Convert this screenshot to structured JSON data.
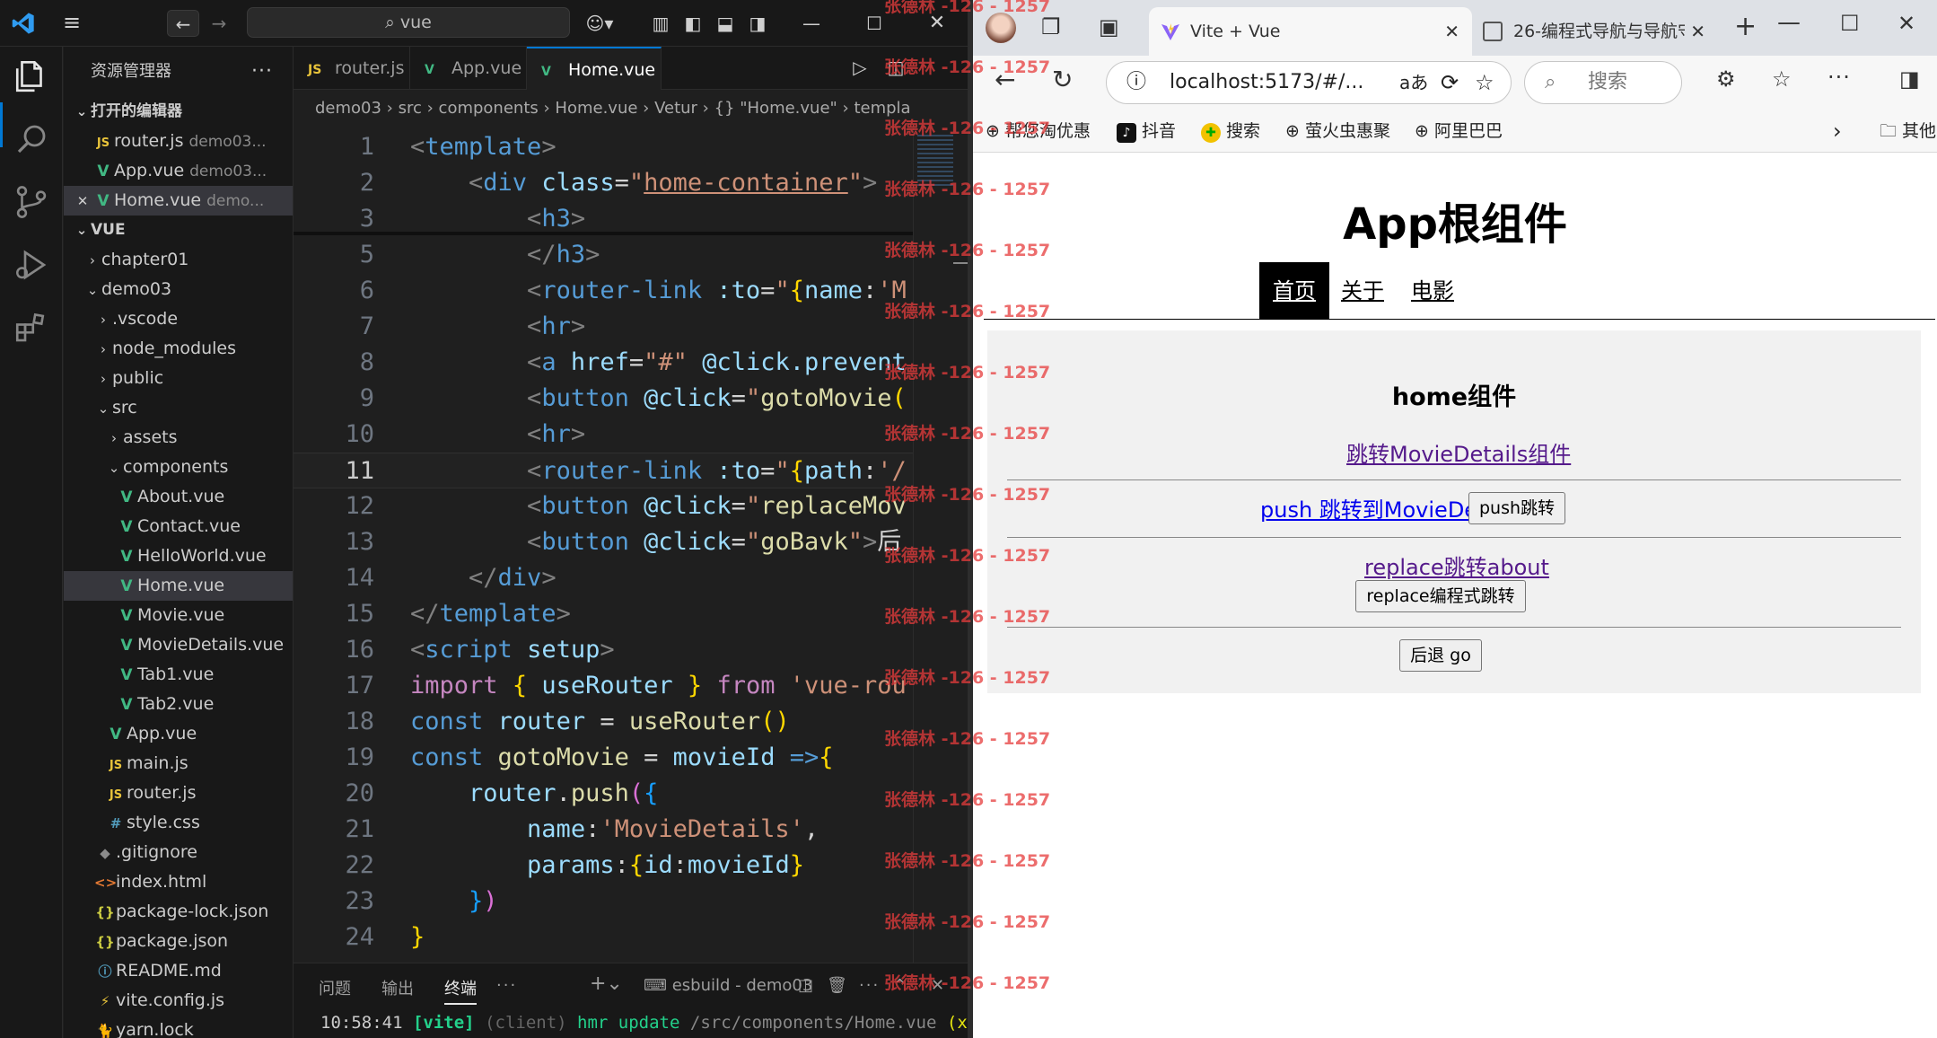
{
  "vscode": {
    "search_text": "vue",
    "explorer_title": "资源管理器",
    "open_editors_label": "打开的编辑器",
    "open_editors": [
      {
        "icon": "JS",
        "name": "router.js",
        "desc": "demo03..."
      },
      {
        "icon": "V",
        "name": "App.vue",
        "desc": "demo03..."
      },
      {
        "icon": "V",
        "name": "Home.vue",
        "desc": "demo..."
      }
    ],
    "workspace_label": "VUE",
    "tree": [
      {
        "name": "chapter01",
        "depth": 1,
        "type": "folder",
        "state": "closed"
      },
      {
        "name": "demo03",
        "depth": 1,
        "type": "folder",
        "state": "open"
      },
      {
        "name": ".vscode",
        "depth": 2,
        "type": "folder",
        "state": "closed"
      },
      {
        "name": "node_modules",
        "depth": 2,
        "type": "folder",
        "state": "closed"
      },
      {
        "name": "public",
        "depth": 2,
        "type": "folder",
        "state": "closed"
      },
      {
        "name": "src",
        "depth": 2,
        "type": "folder",
        "state": "open"
      },
      {
        "name": "assets",
        "depth": 3,
        "type": "folder",
        "state": "closed"
      },
      {
        "name": "components",
        "depth": 3,
        "type": "folder",
        "state": "open"
      },
      {
        "name": "About.vue",
        "depth": 4,
        "type": "vue"
      },
      {
        "name": "Contact.vue",
        "depth": 4,
        "type": "vue"
      },
      {
        "name": "HelloWorld.vue",
        "depth": 4,
        "type": "vue"
      },
      {
        "name": "Home.vue",
        "depth": 4,
        "type": "vue",
        "selected": true
      },
      {
        "name": "Movie.vue",
        "depth": 4,
        "type": "vue"
      },
      {
        "name": "MovieDetails.vue",
        "depth": 4,
        "type": "vue"
      },
      {
        "name": "Tab1.vue",
        "depth": 4,
        "type": "vue"
      },
      {
        "name": "Tab2.vue",
        "depth": 4,
        "type": "vue"
      },
      {
        "name": "App.vue",
        "depth": 3,
        "type": "vue"
      },
      {
        "name": "main.js",
        "depth": 3,
        "type": "js"
      },
      {
        "name": "router.js",
        "depth": 3,
        "type": "js"
      },
      {
        "name": "style.css",
        "depth": 3,
        "type": "css"
      },
      {
        "name": ".gitignore",
        "depth": 2,
        "type": "git"
      },
      {
        "name": "index.html",
        "depth": 2,
        "type": "html"
      },
      {
        "name": "package-lock.json",
        "depth": 2,
        "type": "json"
      },
      {
        "name": "package.json",
        "depth": 2,
        "type": "json"
      },
      {
        "name": "README.md",
        "depth": 2,
        "type": "info"
      },
      {
        "name": "vite.config.js",
        "depth": 2,
        "type": "vite"
      },
      {
        "name": "yarn.lock",
        "depth": 2,
        "type": "yarn"
      }
    ],
    "tabs": [
      {
        "icon": "JS",
        "name": "router.js"
      },
      {
        "icon": "V",
        "name": "App.vue"
      },
      {
        "icon": "V",
        "name": "Home.vue",
        "active": true
      }
    ],
    "breadcrumb": [
      "demo03",
      "src",
      "components",
      "Home.vue",
      "Vetur",
      "{} \"Home.vue\"",
      "templa"
    ],
    "code_lines": [
      {
        "num": "1",
        "html": "<span class='t-br'>&lt;</span><span class='t-tag'>template</span><span class='t-br'>&gt;</span>"
      },
      {
        "num": "2",
        "html": "    <span class='t-br'>&lt;</span><span class='t-tag'>div</span> <span class='t-at'>class</span><span class='t-pl'>=</span><span class='t-str'>\"<u style='text-decoration-color:#ce9178'>home-container</u>\"</span><span class='t-br'>&gt;</span>"
      },
      {
        "num": "3",
        "html": "        <span class='t-br'>&lt;</span><span class='t-tag'>h3</span><span class='t-br'>&gt;</span>"
      },
      {
        "num": "5",
        "html": "        <span class='t-br'>&lt;/</span><span class='t-tag'>h3</span><span class='t-br'>&gt;</span>"
      },
      {
        "num": "6",
        "html": "        <span class='t-br'>&lt;</span><span class='t-tag'>router-link</span> <span class='t-at'>:to</span><span class='t-pl'>=</span><span class='t-str'>\"</span><span class='t-y'>{</span><span class='t-var'>name</span><span class='t-pl'>:</span><span class='t-str'>'M</span>"
      },
      {
        "num": "7",
        "html": "        <span class='t-br'>&lt;</span><span class='t-tag'>hr</span><span class='t-br'>&gt;</span>"
      },
      {
        "num": "8",
        "html": "        <span class='t-br'>&lt;</span><span class='t-tag'>a</span> <span class='t-at'>href</span><span class='t-pl'>=</span><span class='t-str'>\"#\"</span> <span class='t-at'>@click.prevent</span>"
      },
      {
        "num": "9",
        "html": "        <span class='t-br'>&lt;</span><span class='t-tag'>button</span> <span class='t-at'>@click</span><span class='t-pl'>=</span><span class='t-str'>\"</span><span class='t-fn'>gotoMovie</span><span class='t-y'>(</span>"
      },
      {
        "num": "10",
        "html": "        <span class='t-br'>&lt;</span><span class='t-tag'>hr</span><span class='t-br'>&gt;</span>"
      },
      {
        "num": "11",
        "html": "        <span class='t-br'>&lt;</span><span class='t-tag'>router-link</span> <span class='t-at'>:to</span><span class='t-pl'>=</span><span class='t-str'>\"</span><span class='t-y'>{</span><span class='t-var'>path</span><span class='t-pl'>:</span><span class='t-str'>'/</span>",
        "current": true
      },
      {
        "num": "12",
        "html": "        <span class='t-br'>&lt;</span><span class='t-tag'>button</span> <span class='t-at'>@click</span><span class='t-pl'>=</span><span class='t-str'>\"</span><span class='t-fn'>replaceMov</span>"
      },
      {
        "num": "13",
        "html": "        <span class='t-br'>&lt;</span><span class='t-tag'>button</span> <span class='t-at'>@click</span><span class='t-pl'>=</span><span class='t-str'>\"</span><span class='t-fn'>goBavk</span><span class='t-str'>\"</span><span class='t-br'>&gt;</span><span class='t-pl'>后</span>"
      },
      {
        "num": "14",
        "html": "    <span class='t-br'>&lt;/</span><span class='t-tag'>div</span><span class='t-br'>&gt;</span>"
      },
      {
        "num": "15",
        "html": "<span class='t-br'>&lt;/</span><span class='t-tag'>template</span><span class='t-br'>&gt;</span>"
      },
      {
        "num": "16",
        "html": "<span class='t-br'>&lt;</span><span class='t-tag'>script</span> <span class='t-at'>setup</span><span class='t-br'>&gt;</span>"
      },
      {
        "num": "17",
        "html": "<span class='t-kw'>import</span> <span class='t-y'>{</span> <span class='t-var'>useRouter</span> <span class='t-y'>}</span> <span class='t-kw'>from</span> <span class='t-str'>'vue-rou</span>"
      },
      {
        "num": "18",
        "html": "<span class='t-dec'>const</span> <span class='t-var'>router</span> <span class='t-pl'>=</span> <span class='t-fn'>useRouter</span><span class='t-y'>()</span>"
      },
      {
        "num": "19",
        "html": "<span class='t-dec'>const</span> <span class='t-fn'>gotoMovie</span> <span class='t-pl'>=</span> <span class='t-var'>movieId</span> <span class='t-dec'>=&gt;</span><span class='t-y'>{</span>"
      },
      {
        "num": "20",
        "html": "    <span class='t-var'>router</span><span class='t-pl'>.</span><span class='t-fn'>push</span><span class='t-p'>(</span><span class='t-b'>{</span>"
      },
      {
        "num": "21",
        "html": "        <span class='t-var'>name</span><span class='t-pl'>:</span><span class='t-str'>'MovieDetails'</span><span class='t-pl'>,</span>"
      },
      {
        "num": "22",
        "html": "        <span class='t-var'>params</span><span class='t-pl'>:</span><span class='t-y'>{</span><span class='t-var'>id</span><span class='t-pl'>:</span><span class='t-var'>movieId</span><span class='t-y'>}</span>"
      },
      {
        "num": "23",
        "html": "    <span class='t-b'>}</span><span class='t-p'>)</span>"
      },
      {
        "num": "24",
        "html": "<span class='t-y'>}</span>"
      }
    ],
    "panel_tabs": [
      "问题",
      "输出",
      "终端"
    ],
    "terminal_name": "esbuild - demo03",
    "terminal_line": {
      "time": "10:58:41",
      "tag": "[vite]",
      "client": "(client)",
      "msg": "hmr update",
      "path": "/src/components/Home.vue",
      "tail": "(x"
    }
  },
  "browser": {
    "tabs": [
      {
        "title": "Vite + Vue",
        "active": true
      },
      {
        "title": "26-编程式导航与导航守"
      }
    ],
    "address": "localhost:5173/#/...",
    "search_placeholder": "搜索",
    "bookmarks": [
      "帮您淘优惠",
      "抖音",
      "搜索",
      "萤火虫惠聚",
      "阿里巴巴"
    ],
    "other_bookmarks": "其他收藏夹",
    "page": {
      "app_title": "App根组件",
      "nav": [
        "首页",
        "关于",
        "电影"
      ],
      "home_title": "home组件",
      "link1": "跳转MovieDetails组件",
      "link2": "push 跳转到MovieDetails组件",
      "push_button": "push跳转",
      "link3": "replace跳转about",
      "replace_button": "replace编程式跳转",
      "back_button": "后退 go"
    }
  },
  "watermark": "张德林 -126 - 1257",
  "colors": {
    "accent": "#0078d4",
    "vue_green": "#41b883",
    "nav_active_bg": "#000000"
  }
}
